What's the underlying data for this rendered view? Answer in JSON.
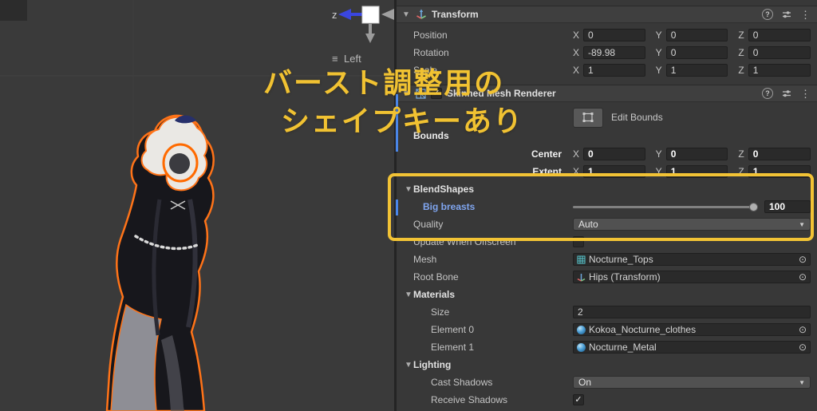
{
  "icons": {
    "foldout_open": "▼",
    "kebab": "⋮",
    "help": "?",
    "picker": "⊙",
    "dropdown_caret": "▼",
    "check": "✓",
    "menu": "≡"
  },
  "scene": {
    "gizmo_axis": "z",
    "view_label": "Left",
    "overlay_line1": "バースト調整用の",
    "overlay_line2": "シェイプキーあり"
  },
  "inspector": {
    "axis": {
      "x": "X",
      "y": "Y",
      "z": "Z"
    },
    "transform": {
      "title": "Transform",
      "position": {
        "label": "Position",
        "x": "0",
        "y": "0",
        "z": "0"
      },
      "rotation": {
        "label": "Rotation",
        "x": "-89.98",
        "y": "0",
        "z": "0"
      },
      "scale": {
        "label": "Scale",
        "x": "1",
        "y": "1",
        "z": "1"
      }
    },
    "smr": {
      "title": "Skinned Mesh Renderer",
      "edit_bounds": "Edit Bounds",
      "bounds": "Bounds",
      "center": {
        "label": "Center",
        "x": "0",
        "y": "0",
        "z": "0"
      },
      "extent": {
        "label": "Extent",
        "x": "1",
        "y": "1",
        "z": "1"
      },
      "blendshapes_title": "BlendShapes",
      "blendshape": {
        "name": "Big breasts",
        "value": "100"
      },
      "quality": {
        "label": "Quality",
        "value": "Auto"
      },
      "update_when_offscreen": "Update When Offscreen",
      "mesh": {
        "label": "Mesh",
        "value": "Nocturne_Tops"
      },
      "root_bone": {
        "label": "Root Bone",
        "value": "Hips (Transform)"
      },
      "materials_title": "Materials",
      "materials_size": {
        "label": "Size",
        "value": "2"
      },
      "materials_elements": [
        {
          "label": "Element 0",
          "value": "Kokoa_Nocturne_clothes"
        },
        {
          "label": "Element 1",
          "value": "Nocturne_Metal"
        }
      ],
      "lighting_title": "Lighting",
      "cast_shadows": {
        "label": "Cast Shadows",
        "value": "On"
      },
      "receive_shadows": {
        "label": "Receive Shadows"
      }
    }
  },
  "colors": {
    "highlight_box": "#F2C335",
    "overlay_text": "#F1C232",
    "override_blue": "#7FA5EF",
    "selection_orange": "#FF7318"
  }
}
